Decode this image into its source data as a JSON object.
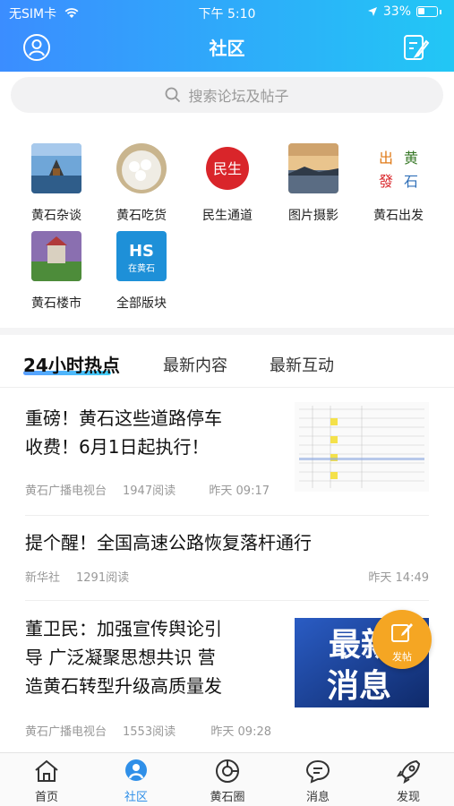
{
  "status": {
    "carrier": "无SIM卡",
    "time": "下午 5:10",
    "battery": "33%"
  },
  "header": {
    "title": "社区"
  },
  "search": {
    "placeholder": "搜索论坛及帖子"
  },
  "forums": [
    {
      "label": "黄石杂谈"
    },
    {
      "label": "黄石吃货"
    },
    {
      "label": "民生通道"
    },
    {
      "label": "图片摄影"
    },
    {
      "label": "黄石出发"
    },
    {
      "label": "黄石楼市"
    },
    {
      "label": "全部版块"
    }
  ],
  "thumb_text": {
    "minsheng": "民生",
    "chufa": [
      "出",
      "黄",
      "發",
      "石"
    ],
    "hs": "HS",
    "hs_sub": "在黄石"
  },
  "tabs": [
    {
      "label": "24小时热点"
    },
    {
      "label": "最新内容"
    },
    {
      "label": "最新互动"
    }
  ],
  "posts": [
    {
      "title_lines": [
        "重磅！黄石这些道路停车",
        "收费！6月1日起执行！"
      ],
      "source": "黄石广播电视台",
      "reads": "1947阅读",
      "time": "昨天 09:17"
    },
    {
      "title_lines": [
        "提个醒！全国高速公路恢复落杆通行"
      ],
      "source": "新华社",
      "reads": "1291阅读",
      "time": "昨天 14:49"
    },
    {
      "title_lines": [
        "董卫民：加强宣传舆论引",
        "导 广泛凝聚思想共识 营",
        "造黄石转型升级高质量发"
      ],
      "source": "黄石广播电视台",
      "reads": "1553阅读",
      "time": "昨天 09:28"
    }
  ],
  "post_image_text": {
    "line1": "最新",
    "line2": "消息"
  },
  "fab": {
    "label": "发帖"
  },
  "tabbar": [
    {
      "label": "首页",
      "icon": "home-icon"
    },
    {
      "label": "社区",
      "icon": "community-icon"
    },
    {
      "label": "黄石圈",
      "icon": "circle-icon"
    },
    {
      "label": "消息",
      "icon": "message-icon"
    },
    {
      "label": "发现",
      "icon": "rocket-icon"
    }
  ],
  "colors": {
    "accent": "#2f8fe8",
    "header_start": "#3b8dff",
    "header_end": "#22c7f5",
    "fab": "#f5a623"
  }
}
